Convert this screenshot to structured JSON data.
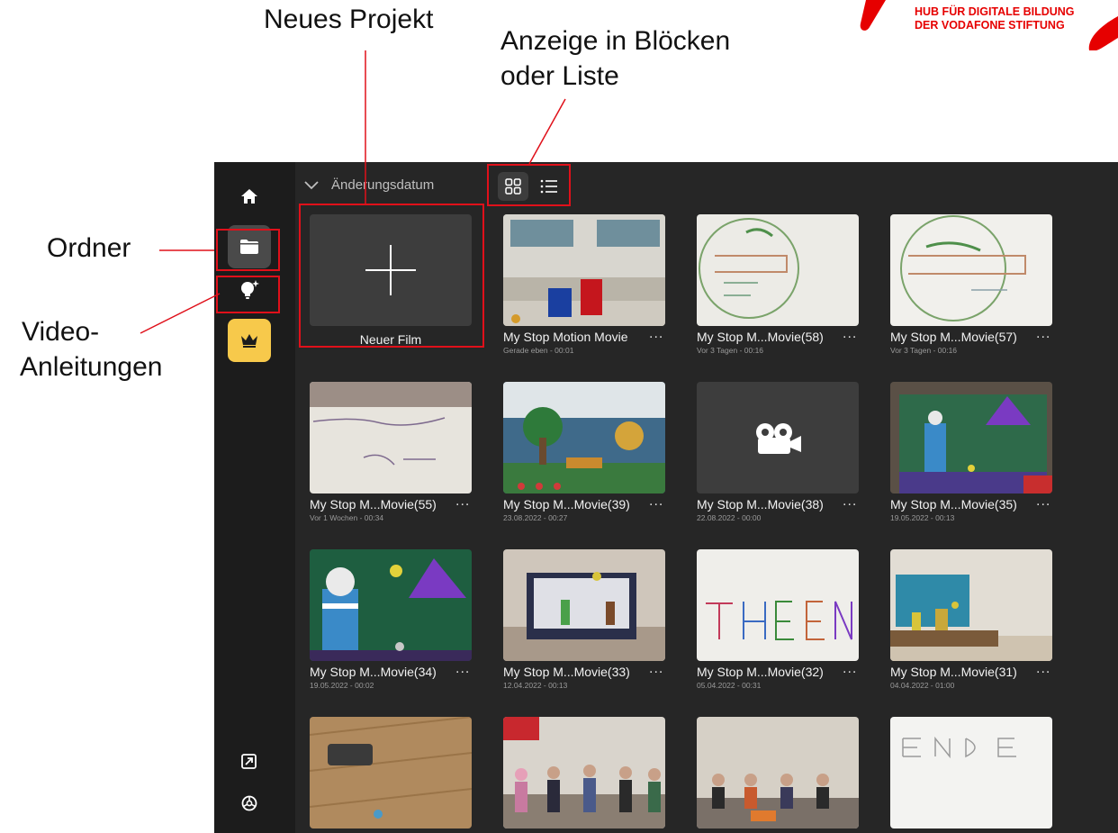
{
  "annotations": {
    "new_project": "Neues Projekt",
    "view_mode_line1": "Anzeige in Blöcken",
    "view_mode_line2": "oder Liste",
    "folder": "Ordner",
    "video_line1": "Video-",
    "video_line2": "Anleitungen"
  },
  "logo": {
    "line1": "HUB FÜR DIGITALE BILDUNG",
    "line2": "DER VODAFONE STIFTUNG",
    "color": "#e60000"
  },
  "sidebar": {
    "icons": [
      "home-icon",
      "folder-icon",
      "lightbulb-icon",
      "crown-icon",
      "export-icon",
      "settings-icon"
    ],
    "active": "folder-icon",
    "premium_color": "#f7c94b"
  },
  "toolbar": {
    "sort_label": "Änderungsdatum",
    "view_modes": [
      "grid-view-icon",
      "list-view-icon"
    ],
    "selected_view": "grid-view-icon"
  },
  "new_movie": {
    "label": "Neuer Film"
  },
  "movies": [
    {
      "title": "My Stop Motion Movie",
      "sub": "Gerade eben - 00:01"
    },
    {
      "title": "My Stop M...Movie(58)",
      "sub": "Vor 3 Tagen - 00:16"
    },
    {
      "title": "My Stop M...Movie(57)",
      "sub": "Vor 3 Tagen - 00:16"
    },
    {
      "title": "My Stop M...Movie(55)",
      "sub": "Vor 1 Wochen - 00:34"
    },
    {
      "title": "My Stop M...Movie(39)",
      "sub": "23.08.2022 - 00:27"
    },
    {
      "title": "My Stop M...Movie(38)",
      "sub": "22.08.2022 - 00:00"
    },
    {
      "title": "My Stop M...Movie(35)",
      "sub": "19.05.2022 - 00:13"
    },
    {
      "title": "My Stop M...Movie(34)",
      "sub": "19.05.2022 - 00:02"
    },
    {
      "title": "My Stop M...Movie(33)",
      "sub": "12.04.2022 - 00:13"
    },
    {
      "title": "My Stop M...Movie(32)",
      "sub": "05.04.2022 - 00:31"
    },
    {
      "title": "My Stop M...Movie(31)",
      "sub": "04.04.2022 - 01:00"
    }
  ],
  "more_label": "...",
  "highlight_color": "#e0101a"
}
